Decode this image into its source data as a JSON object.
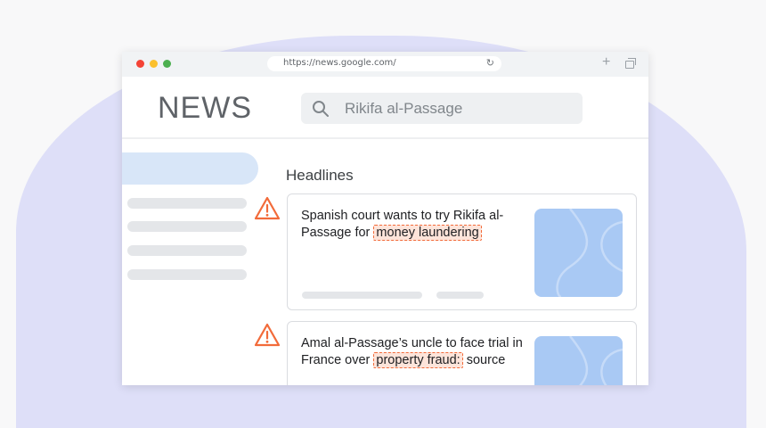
{
  "browser": {
    "url": "https://news.google.com/",
    "reload_icon": "reload-icon",
    "new_tab_icon": "plus-icon",
    "window_icon": "restore-window-icon"
  },
  "app": {
    "logo": "NEWS"
  },
  "search": {
    "query": "Rikifa al-Passage",
    "icon": "search-icon"
  },
  "main": {
    "section_title": "Headlines",
    "articles": [
      {
        "text_before": "Spanish court wants to try Rikifa al-Passage for ",
        "flagged": "money laundering",
        "text_after": "",
        "warning_icon": "warning-icon"
      },
      {
        "text_before": "Amal al-Passage’s uncle to face trial in France over ",
        "flagged": "property fraud:",
        "text_after": " source",
        "warning_icon": "warning-icon"
      }
    ]
  },
  "colors": {
    "accent_blob": "#dedff8",
    "sidebar_active": "#d8e6f8",
    "warning": "#f26b3a",
    "thumbnail": "#a9c9f4"
  }
}
